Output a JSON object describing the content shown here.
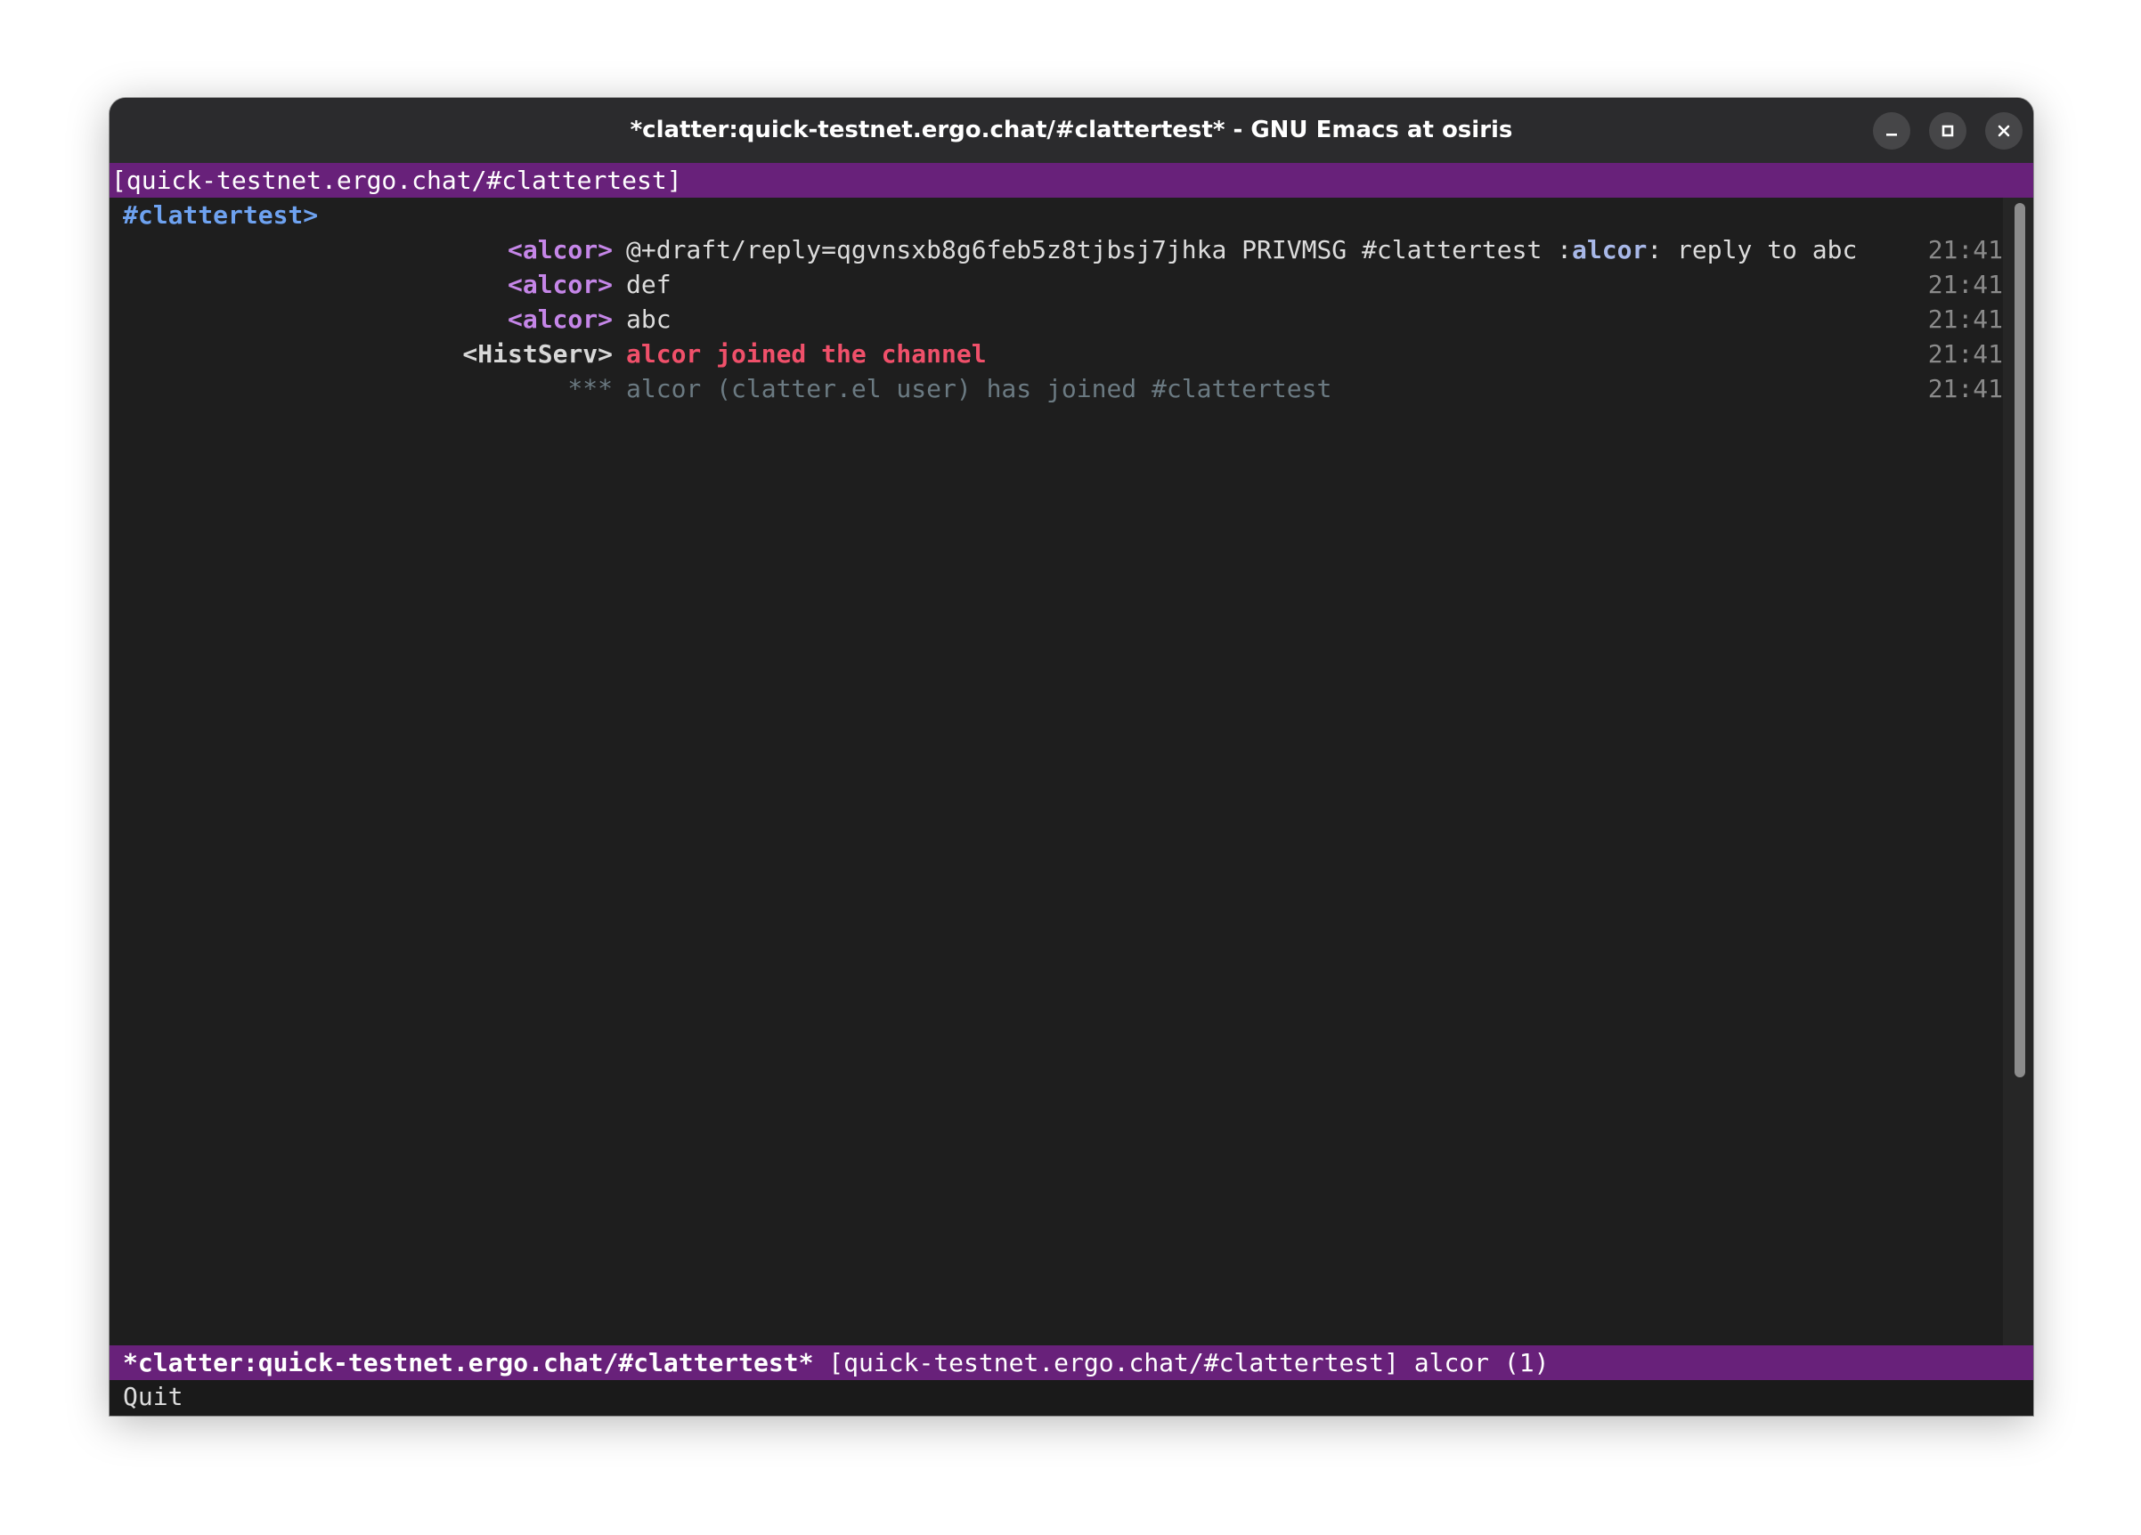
{
  "window": {
    "title": "*clatter:quick-testnet.ergo.chat/#clattertest* - GNU Emacs at osiris"
  },
  "header_line": "[quick-testnet.ergo.chat/#clattertest]",
  "buffer": {
    "prompt": "#clattertest>",
    "messages": [
      {
        "nick": "<alcor>",
        "text_prefix": "@+draft/reply=qgvnsxb8g6feb5z8tjbsj7jhka PRIVMSG #clattertest :",
        "highlight": "alcor",
        "text_suffix": ": reply to abc",
        "time": "21:41"
      },
      {
        "nick": "<alcor>",
        "text": "def",
        "time": "21:41"
      },
      {
        "nick": "<alcor>",
        "text": "abc",
        "time": "21:41"
      },
      {
        "nick": "<HistServ>",
        "text": "alcor joined the channel",
        "time": "21:41"
      },
      {
        "nick": "***",
        "text": "alcor (clatter.el user) has joined #clattertest",
        "time": "21:41"
      }
    ]
  },
  "mode_line": {
    "buffer_name": "*clatter:quick-testnet.ergo.chat/#clattertest*",
    "rest": " [quick-testnet.ergo.chat/#clattertest] alcor (1)"
  },
  "echo_area": "Quit",
  "icons": {
    "minimize": "minimize-icon",
    "maximize": "maximize-icon",
    "close": "close-icon"
  },
  "colors": {
    "mode_line_bg": "#68217a",
    "buffer_bg": "#1e1e1e",
    "nick_alcor": "#c586e8",
    "join_notice": "#f0506a",
    "prompt": "#6ea2f0"
  }
}
